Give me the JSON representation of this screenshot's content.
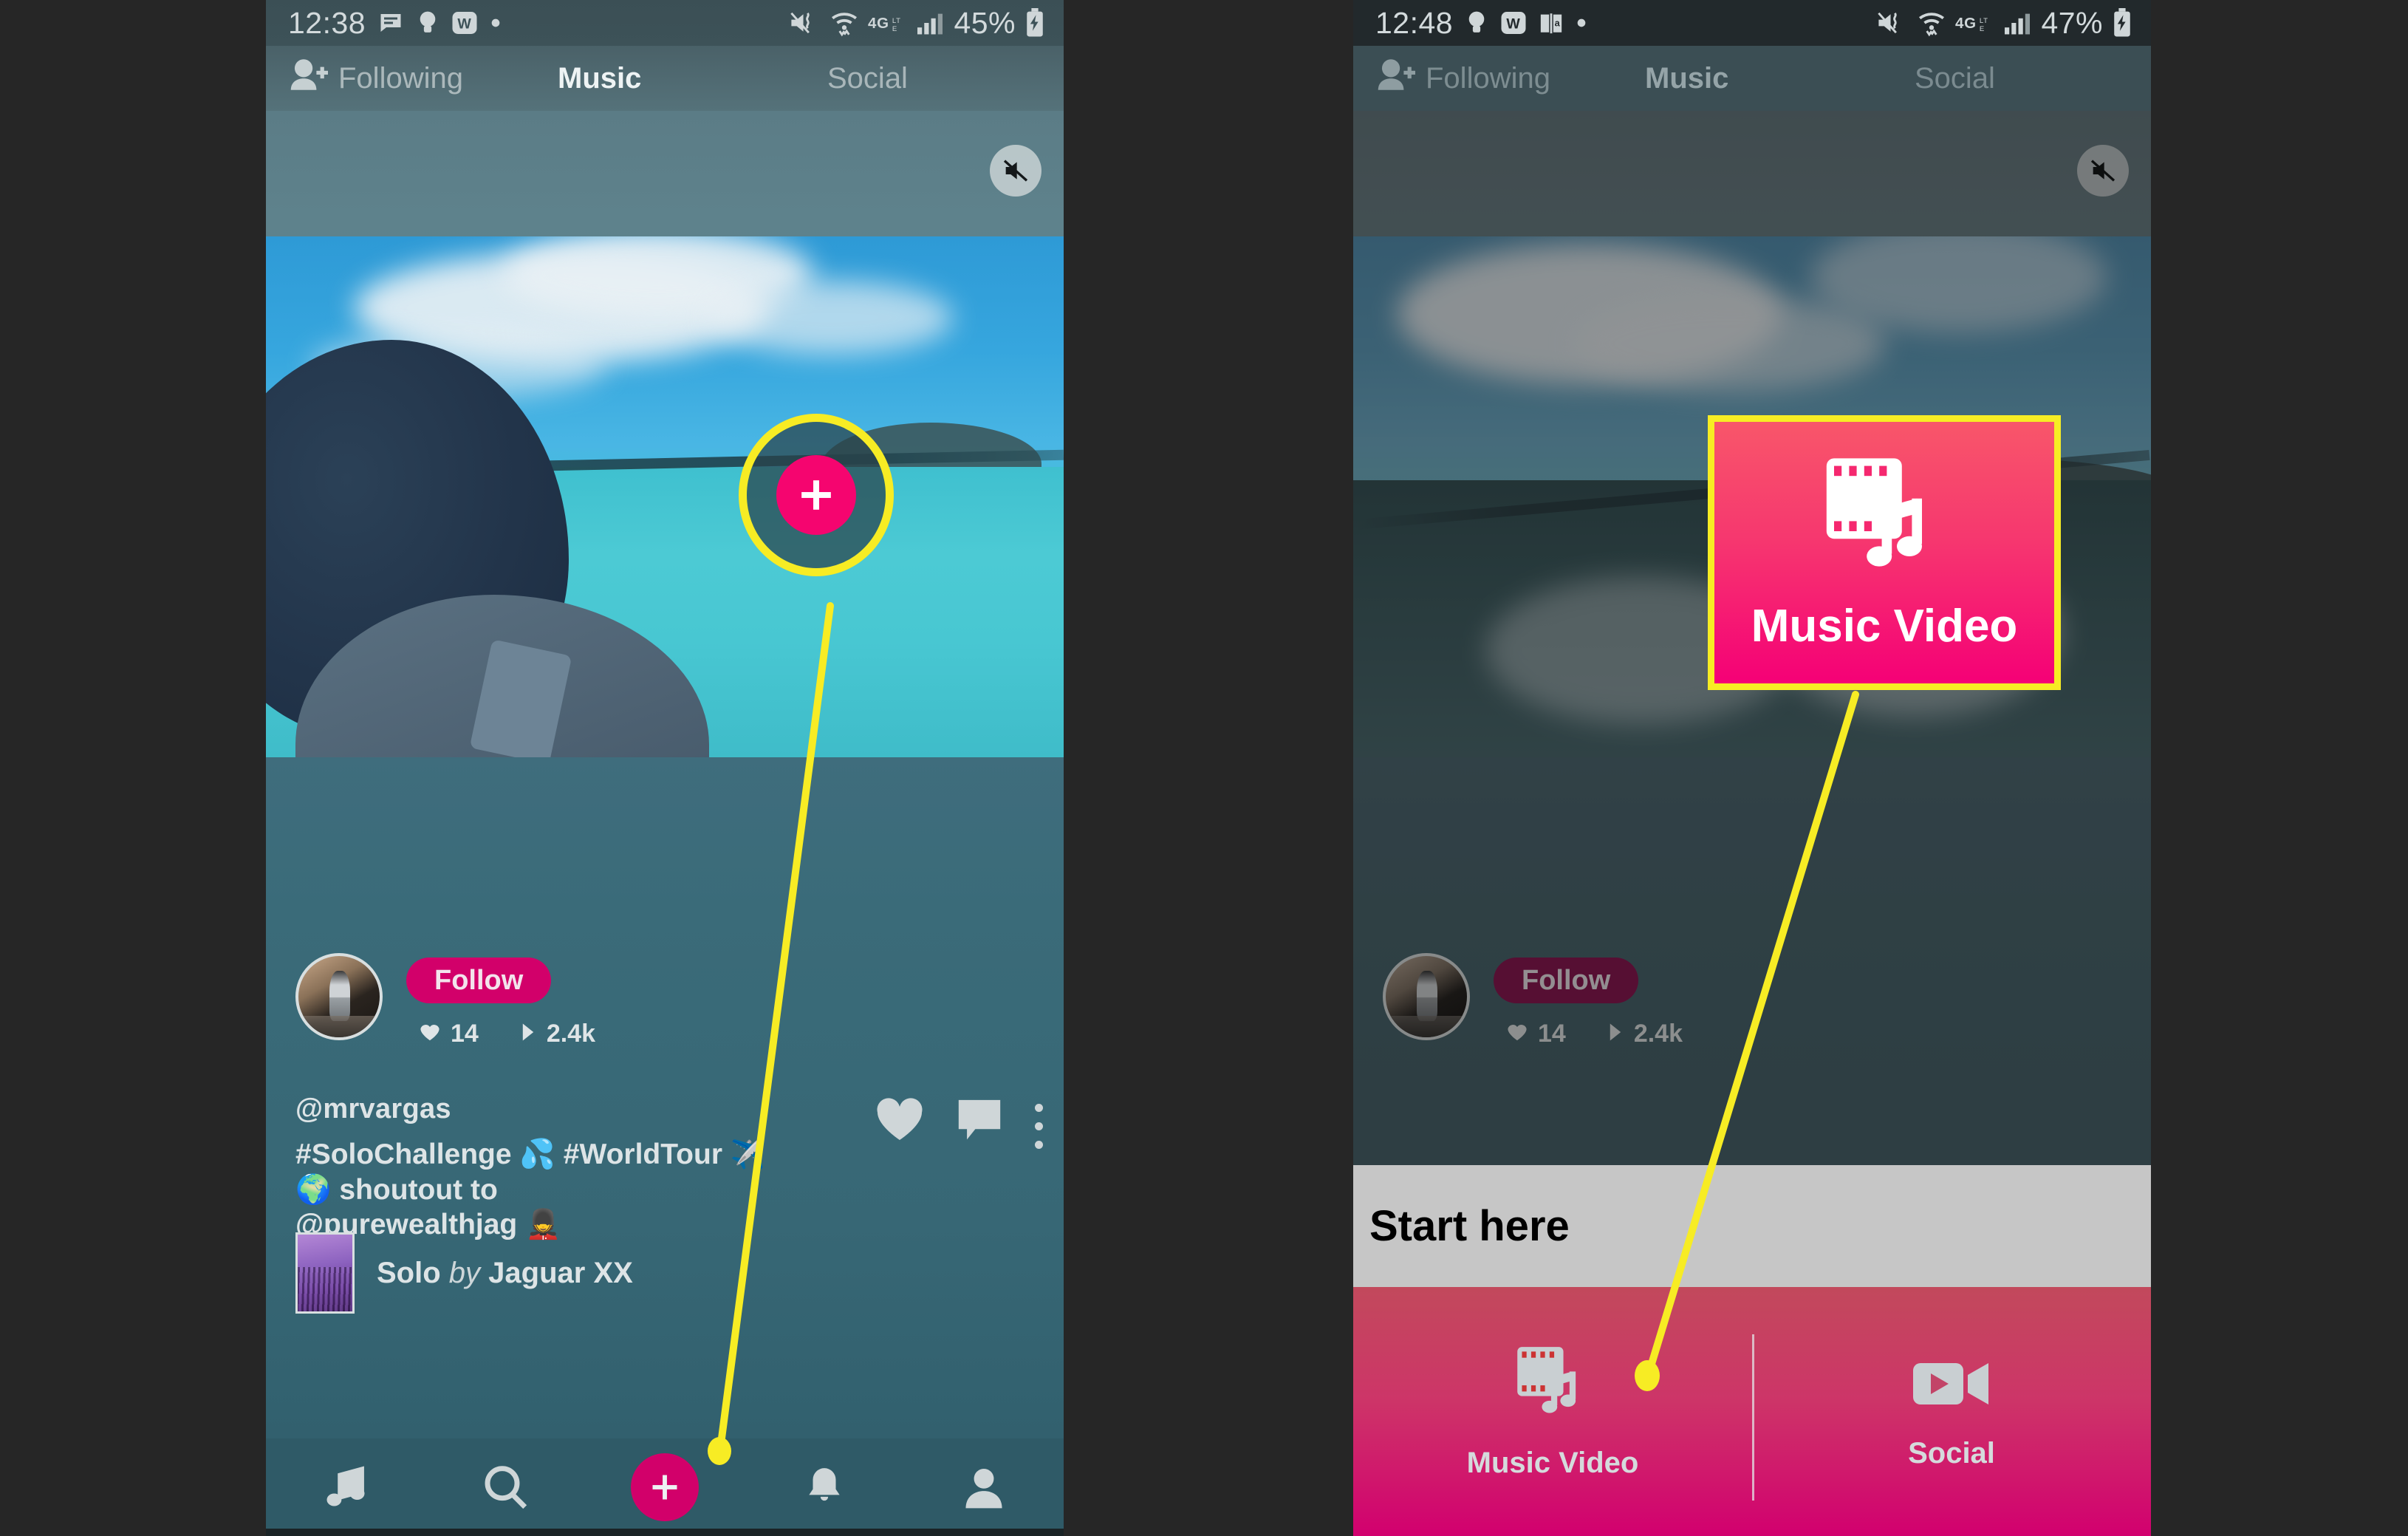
{
  "background_color": "#262626",
  "accent_pink": "#d2006a",
  "highlight_yellow": "#f7ec24",
  "phones": [
    {
      "id": "left",
      "status_bar": {
        "time": "12:38",
        "battery_percent": "45%",
        "network": "4G LTE",
        "left_icons": [
          "message-icon",
          "bulb-icon",
          "wikipedia-icon",
          "dot-icon"
        ],
        "right_icons": [
          "mute-vibrate-icon",
          "wifi-icon",
          "4glte-icon",
          "signal-icon",
          "battery-charging-icon"
        ]
      },
      "top_tabs": [
        {
          "label": "Following",
          "icon": "person-add-icon",
          "active": false
        },
        {
          "label": "Music",
          "active": true
        },
        {
          "label": "Social",
          "active": false
        }
      ],
      "video": {
        "mute_icon": "mute-speaker-icon",
        "handle": "@mrvargas",
        "caption_line1": "#SoloChallenge 💦 #WorldTour ✈️🌍 shoutout to",
        "caption_line2": "@purewealthjag 💂",
        "follow_label": "Follow",
        "likes": "14",
        "plays": "2.4k",
        "song_title": "Solo",
        "song_by": "by",
        "song_artist": "Jaguar XX",
        "actions": [
          "heart-icon",
          "comment-icon",
          "more-options-icon"
        ]
      },
      "bottom_nav": [
        {
          "name": "music-note-icon"
        },
        {
          "name": "search-icon"
        },
        {
          "name": "create-plus-button"
        },
        {
          "name": "bell-icon"
        },
        {
          "name": "profile-icon"
        }
      ],
      "callout": {
        "type": "circle-highlight",
        "target": "create-plus-button",
        "inner_icon": "plus-icon"
      }
    },
    {
      "id": "right",
      "status_bar": {
        "time": "12:48",
        "battery_percent": "47%",
        "network": "4G LTE",
        "left_icons": [
          "bulb-icon",
          "wikipedia-icon",
          "book-icon",
          "dot-icon"
        ],
        "right_icons": [
          "mute-vibrate-icon",
          "wifi-icon",
          "4glte-icon",
          "signal-icon",
          "battery-charging-icon"
        ]
      },
      "top_tabs": [
        {
          "label": "Following",
          "icon": "person-add-icon",
          "active": false
        },
        {
          "label": "Music",
          "active": true
        },
        {
          "label": "Social",
          "active": false
        }
      ],
      "video": {
        "mute_icon": "mute-speaker-icon",
        "follow_label": "Follow",
        "likes": "14",
        "plays": "2.4k"
      },
      "sheet": {
        "title": "Start here",
        "options": [
          {
            "label": "Music Video",
            "icon": "film-music-icon"
          },
          {
            "label": "Social",
            "icon": "video-camera-icon"
          }
        ]
      },
      "callout": {
        "type": "card",
        "label": "Music Video",
        "icon": "film-music-icon",
        "target": "sheet-option-music-video"
      }
    }
  ]
}
